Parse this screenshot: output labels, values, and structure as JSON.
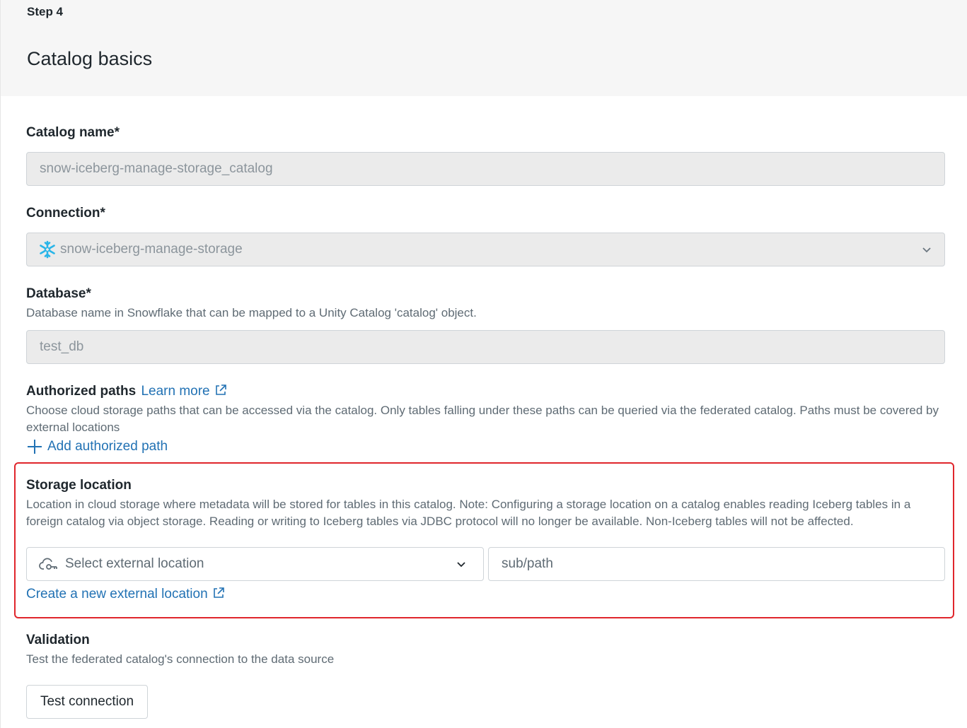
{
  "header": {
    "step": "Step 4",
    "title": "Catalog basics"
  },
  "catalog_name": {
    "label": "Catalog name*",
    "value": "snow-iceberg-manage-storage_catalog"
  },
  "connection": {
    "label": "Connection*",
    "value": "snow-iceberg-manage-storage",
    "icon": "snowflake-icon"
  },
  "database": {
    "label": "Database*",
    "description": "Database name in Snowflake that can be mapped to a Unity Catalog 'catalog' object.",
    "value": "test_db"
  },
  "authorized_paths": {
    "label": "Authorized paths",
    "learn_more": "Learn more",
    "description": "Choose cloud storage paths that can be accessed via the catalog. Only tables falling under these paths can be queried via the federated catalog. Paths must be covered by external locations",
    "add_label": "Add authorized path"
  },
  "storage_location": {
    "label": "Storage location",
    "description": "Location in cloud storage where metadata will be stored for tables in this catalog. Note: Configuring a storage location on a catalog enables reading Iceberg tables in a foreign catalog via object storage. Reading or writing to Iceberg tables via JDBC protocol will no longer be available. Non-Iceberg tables will not be affected.",
    "select_placeholder": "Select external location",
    "subpath_placeholder": "sub/path",
    "create_link": "Create a new external location"
  },
  "validation": {
    "label": "Validation",
    "description": "Test the federated catalog's connection to the data source",
    "button": "Test connection"
  },
  "colors": {
    "accent": "#2272b4",
    "highlight": "#e0262c",
    "header_bg": "#f6f6f6"
  }
}
